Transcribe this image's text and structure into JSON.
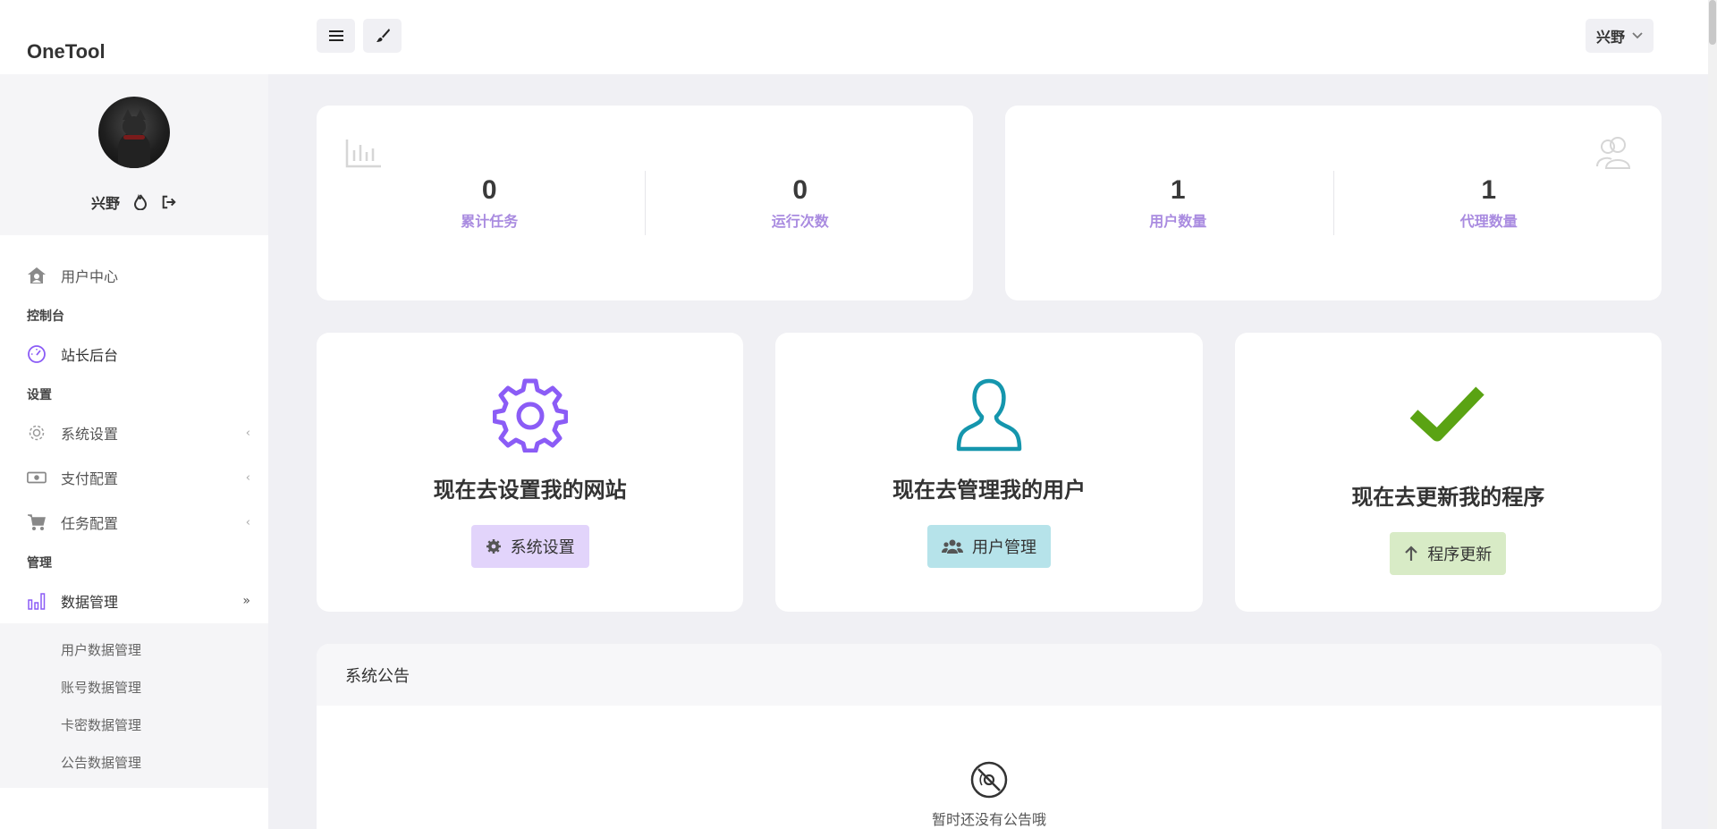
{
  "brand": {
    "name": "OneTool"
  },
  "user": {
    "name": "兴野"
  },
  "topbar": {
    "user_menu_label": "兴野"
  },
  "sidebar": {
    "user_center": "用户中心",
    "sections": [
      {
        "header": "控制台"
      },
      {
        "header": "设置"
      },
      {
        "header": "管理"
      }
    ],
    "items": {
      "dashboard": "站长后台",
      "system_settings": "系统设置",
      "payment_config": "支付配置",
      "task_config": "任务配置",
      "data_management": "数据管理"
    },
    "submenu": [
      "用户数据管理",
      "账号数据管理",
      "卡密数据管理",
      "公告数据管理"
    ]
  },
  "stats": {
    "left": [
      {
        "value": "0",
        "label": "累计任务"
      },
      {
        "value": "0",
        "label": "运行次数"
      }
    ],
    "right": [
      {
        "value": "1",
        "label": "用户数量"
      },
      {
        "value": "1",
        "label": "代理数量"
      }
    ]
  },
  "actions": [
    {
      "title": "现在去设置我的网站",
      "button": "系统设置",
      "color": "#8b5cf6"
    },
    {
      "title": "现在去管理我的用户",
      "button": "用户管理",
      "color": "#1596ad"
    },
    {
      "title": "现在去更新我的程序",
      "button": "程序更新",
      "color": "#5aa313"
    }
  ],
  "notice": {
    "title": "系统公告",
    "empty_text": "暂时还没有公告哦"
  },
  "colors": {
    "accent_purple": "#8b5cf6",
    "stat_label": "#a98be0",
    "background": "#f0f0f4"
  }
}
